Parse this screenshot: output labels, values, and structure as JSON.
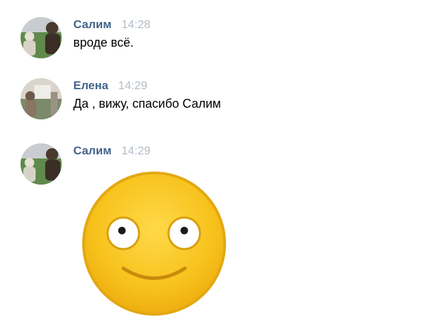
{
  "messages": [
    {
      "author": "Салим",
      "time": "14:28",
      "text": "вроде всё.",
      "avatar_icon": "user-avatar-salim"
    },
    {
      "author": "Елена",
      "time": "14:29",
      "text": "Да , вижу, спасибо Салим",
      "avatar_icon": "user-avatar-elena"
    },
    {
      "author": "Салим",
      "time": "14:29",
      "sticker_icon": "smiley-face-sticker",
      "avatar_icon": "user-avatar-salim"
    }
  ],
  "colors": {
    "author": "#42648b",
    "time": "#b4bcc8",
    "text": "#000000",
    "sticker_face": "#f5c518",
    "sticker_outline": "#e3a812",
    "sticker_mouth": "#c98a0c"
  }
}
